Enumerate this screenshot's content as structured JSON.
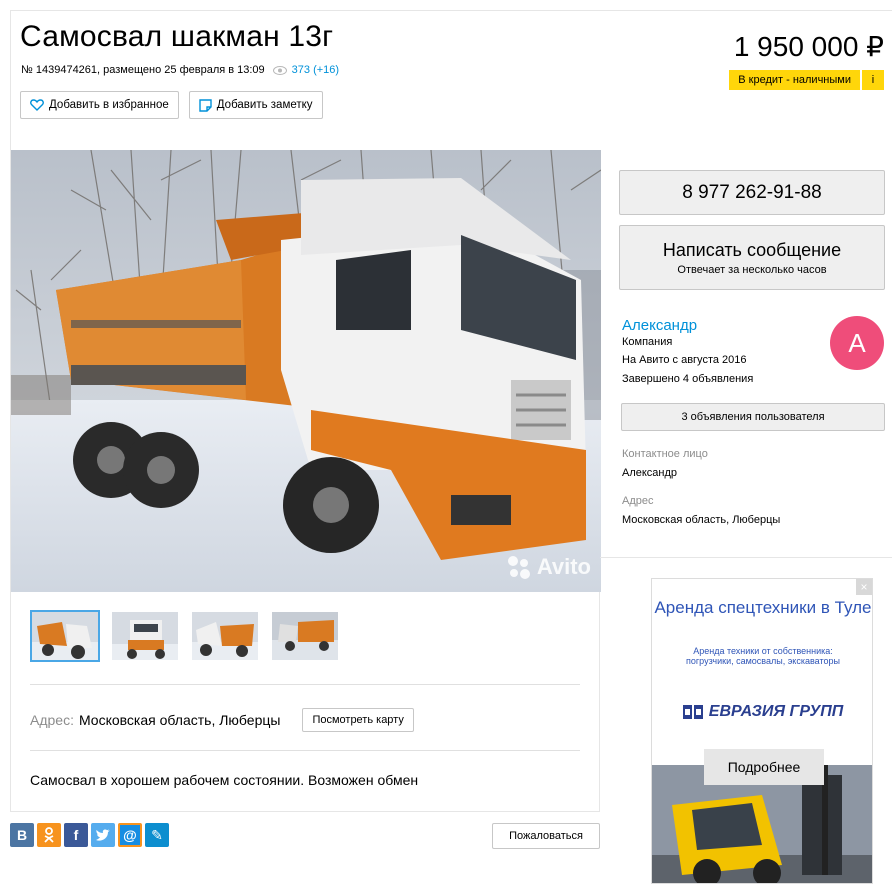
{
  "header": {
    "title": "Самосвал шакман 13г",
    "meta": "№ 1439474261, размещено 25 февраля в 13:09",
    "views": "373 (+16)",
    "fav_label": "Добавить в избранное",
    "note_label": "Добавить заметку",
    "price": "1 950 000 ₽",
    "credit_label": "В кредит - наличными",
    "credit_extra": "i"
  },
  "gallery": {
    "watermark": "Avito",
    "thumb_count": 4
  },
  "address": {
    "label": "Адрес:",
    "value": "Московская область, Люберцы",
    "map_button": "Посмотреть карту"
  },
  "description": "Самосвал в хорошем рабочем состоянии. Возможен обмен",
  "share": {
    "items": [
      "В",
      "ok",
      "f",
      "t",
      "@",
      "✎"
    ],
    "colors": [
      "#4c75a3",
      "#f7931e",
      "#3b5998",
      "#55acee",
      "#168de2",
      "#0d8ecf"
    ]
  },
  "complain_label": "Пожаловаться",
  "seller": {
    "phone": "8 977 262-91-88",
    "message_title": "Написать сообщение",
    "message_sub": "Отвечает за несколько часов",
    "name": "Александр",
    "type": "Компания",
    "since": "На Авито с августа 2016",
    "completed": "Завершено 4 объявления",
    "avatar_letter": "А",
    "avatar_color": "#ef4d7a",
    "ads_button": "3 объявления пользователя",
    "contact_label": "Контактное лицо",
    "contact_value": "Александр",
    "addr_label": "Адрес",
    "addr_value": "Московская область, Люберцы"
  },
  "ad": {
    "heading": "Аренда спецтехники в Туле",
    "sub": "Аренда техники от собственника: погрузчики, самосвалы, экскаваторы",
    "brand": "ЕВРАЗИЯ ГРУПП",
    "more": "Подробнее",
    "close": "×"
  }
}
